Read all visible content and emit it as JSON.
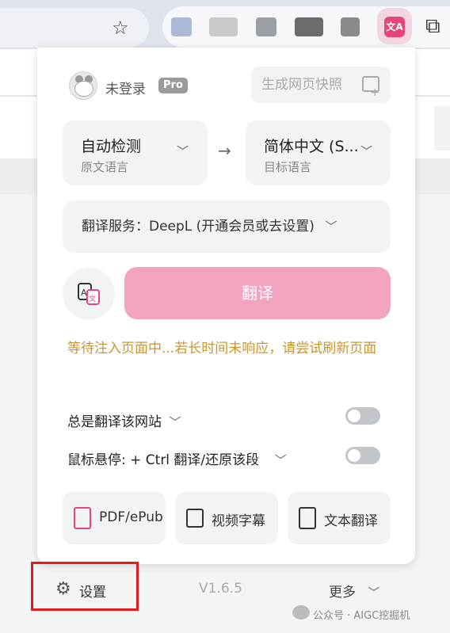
{
  "browser": {
    "bookmark_icon": "star-icon",
    "extensions_icon": "puzzle-icon",
    "active_extension_label": "文A"
  },
  "popup": {
    "user": {
      "status": "未登录",
      "badge": "Pro"
    },
    "snapshot_button": "生成网页快照",
    "source_lang": {
      "value": "自动检测",
      "caption": "原文语言"
    },
    "target_lang": {
      "value": "简体中文 (S...",
      "caption": "目标语言"
    },
    "service": "翻译服务：DeepL (开通会员或去设置)",
    "translate_button": "翻译",
    "status_message": "等待注入页面中...若长时间未响应，请尝试刷新页面",
    "options": [
      {
        "label": "总是翻译该网站",
        "enabled": false
      },
      {
        "label": "鼠标悬停:  + Ctrl 翻译/还原该段",
        "enabled": false
      }
    ],
    "tools": [
      {
        "label": "PDF/ePub",
        "icon": "pdf-icon"
      },
      {
        "label": "视频字幕",
        "icon": "video-subtitle-icon"
      },
      {
        "label": "文本翻译",
        "icon": "text-translate-icon"
      }
    ]
  },
  "footer": {
    "settings": "设置",
    "version": "V1.6.5",
    "more": "更多"
  },
  "watermark": "公众号 · AIGC挖掘机",
  "colors": {
    "accent": "#e4467b",
    "translate_button": "#f3a3c2",
    "status_text": "#c89631",
    "highlight_box": "#e21b1b"
  }
}
